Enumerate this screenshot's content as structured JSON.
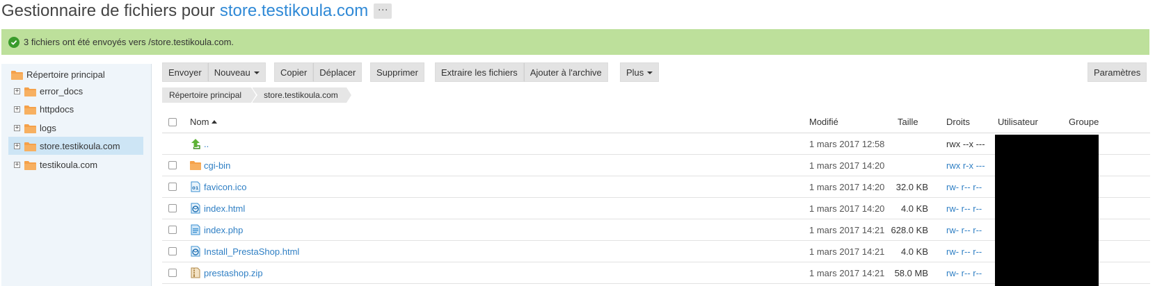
{
  "header": {
    "title_prefix": "Gestionnaire de fichiers pour",
    "domain": "store.testikoula.com",
    "more_label": "···"
  },
  "message": {
    "text": "3 fichiers ont été envoyés vers /store.testikoula.com.",
    "icon": "check-circle-icon",
    "color": "#bde09b"
  },
  "sidebar": {
    "root_label": "Répertoire principal",
    "items": [
      {
        "label": "error_docs",
        "selected": false
      },
      {
        "label": "httpdocs",
        "selected": false
      },
      {
        "label": "logs",
        "selected": false
      },
      {
        "label": "store.testikoula.com",
        "selected": true
      },
      {
        "label": "testikoula.com",
        "selected": false
      }
    ]
  },
  "toolbar": {
    "upload": "Envoyer",
    "new": "Nouveau",
    "copy": "Copier",
    "move": "Déplacer",
    "delete": "Supprimer",
    "extract": "Extraire les fichiers",
    "archive": "Ajouter à l'archive",
    "more": "Plus",
    "settings": "Paramètres"
  },
  "breadcrumb": [
    "Répertoire principal",
    "store.testikoula.com"
  ],
  "table": {
    "columns": {
      "name": "Nom",
      "modified": "Modifié",
      "size": "Taille",
      "rights": "Droits",
      "user": "Utilisateur",
      "group": "Groupe"
    },
    "rows": [
      {
        "name": "..",
        "type": "up",
        "modified": "1 mars 2017 12:58",
        "size": "",
        "rights": "rwx --x ---",
        "rights_link": false,
        "checkbox": false,
        "menu": false
      },
      {
        "name": "cgi-bin",
        "type": "folder",
        "modified": "1 mars 2017 14:20",
        "size": "",
        "rights": "rwx r-x ---",
        "rights_link": true,
        "checkbox": true,
        "menu": true
      },
      {
        "name": "favicon.ico",
        "type": "ico",
        "modified": "1 mars 2017 14:20",
        "size": "32.0 KB",
        "rights": "rw- r-- r--",
        "rights_link": true,
        "checkbox": true,
        "menu": true
      },
      {
        "name": "index.html",
        "type": "html",
        "modified": "1 mars 2017 14:20",
        "size": "4.0 KB",
        "rights": "rw- r-- r--",
        "rights_link": true,
        "checkbox": true,
        "menu": true
      },
      {
        "name": "index.php",
        "type": "php",
        "modified": "1 mars 2017 14:21",
        "size": "628.0 KB",
        "rights": "rw- r-- r--",
        "rights_link": true,
        "checkbox": true,
        "menu": true
      },
      {
        "name": "Install_PrestaShop.html",
        "type": "html",
        "modified": "1 mars 2017 14:21",
        "size": "4.0 KB",
        "rights": "rw- r-- r--",
        "rights_link": true,
        "checkbox": true,
        "menu": true
      },
      {
        "name": "prestashop.zip",
        "type": "zip",
        "modified": "1 mars 2017 14:21",
        "size": "58.0 MB",
        "rights": "rw- r-- r--",
        "rights_link": true,
        "checkbox": true,
        "menu": true
      }
    ]
  }
}
